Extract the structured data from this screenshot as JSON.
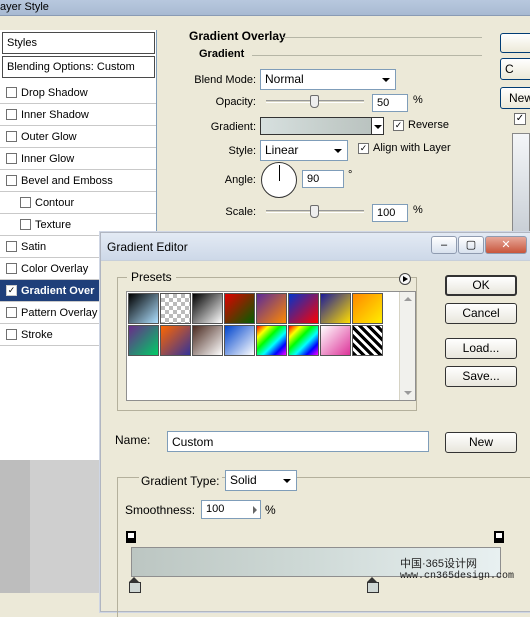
{
  "layer_style": {
    "title": "ayer Style",
    "styles_header": "Styles",
    "blending_options": "Blending Options: Custom",
    "items": [
      {
        "label": "Drop Shadow",
        "checked": false,
        "indent": false,
        "selected": false
      },
      {
        "label": "Inner Shadow",
        "checked": false,
        "indent": false,
        "selected": false
      },
      {
        "label": "Outer Glow",
        "checked": false,
        "indent": false,
        "selected": false
      },
      {
        "label": "Inner Glow",
        "checked": false,
        "indent": false,
        "selected": false
      },
      {
        "label": "Bevel and Emboss",
        "checked": false,
        "indent": false,
        "selected": false
      },
      {
        "label": "Contour",
        "checked": false,
        "indent": true,
        "selected": false
      },
      {
        "label": "Texture",
        "checked": false,
        "indent": true,
        "selected": false
      },
      {
        "label": "Satin",
        "checked": false,
        "indent": false,
        "selected": false
      },
      {
        "label": "Color Overlay",
        "checked": false,
        "indent": false,
        "selected": false
      },
      {
        "label": "Gradient Over",
        "checked": true,
        "indent": false,
        "selected": true
      },
      {
        "label": "Pattern Overlay",
        "checked": false,
        "indent": false,
        "selected": false
      },
      {
        "label": "Stroke",
        "checked": false,
        "indent": false,
        "selected": false
      }
    ],
    "panel": {
      "section_title": "Gradient Overlay",
      "group_title": "Gradient",
      "blend_mode_label": "Blend Mode:",
      "blend_mode_value": "Normal",
      "opacity_label": "Opacity:",
      "opacity_value": "50",
      "opacity_unit": "%",
      "opacity_level": 0.5,
      "gradient_label": "Gradient:",
      "reverse_label": "Reverse",
      "reverse_checked": true,
      "style_label": "Style:",
      "style_value": "Linear",
      "align_label": "Align with Layer",
      "align_checked": true,
      "angle_label": "Angle:",
      "angle_value": "90",
      "angle_unit": "°",
      "scale_label": "Scale:",
      "scale_value": "100",
      "scale_unit": "%",
      "scale_level": 0.5
    },
    "side_buttons": [
      "",
      "C",
      "New"
    ]
  },
  "gradient_editor": {
    "title": "Gradient Editor",
    "presets_label": "Presets",
    "buttons": {
      "ok": "OK",
      "cancel": "Cancel",
      "load": "Load...",
      "save": "Save...",
      "new": "New"
    },
    "name_label": "Name:",
    "name_value": "Custom",
    "gradient_type_label": "Gradient Type:",
    "gradient_type_value": "Solid",
    "smoothness_label": "Smoothness:",
    "smoothness_value": "100",
    "smoothness_unit": "%",
    "swatch_colors": [
      [
        "#000000",
        "#aee0ff"
      ],
      [
        "#777777",
        "#ffffff"
      ],
      [
        "#000000",
        "#ffffff"
      ],
      [
        "#e00000",
        "#006000"
      ],
      [
        "#5a2a9a",
        "#ff8a00"
      ],
      [
        "#0033cc",
        "#ff0000"
      ],
      [
        "#1a1a9a",
        "#ffdd00"
      ],
      [
        "#ff8800",
        "#ffee00"
      ],
      [
        "#6a2a8a",
        "#00cc66"
      ],
      [
        "#ff6600",
        "#333399"
      ],
      [
        "#4a2a20",
        "#ffffff"
      ],
      [
        "#0044cc",
        "#ffffff"
      ],
      [
        "#ff0000",
        "#00ff88"
      ],
      [
        "#ff0099",
        "#00ccff"
      ],
      [
        "#ffffff",
        "#dd3399"
      ],
      [
        "#000000",
        "#ffffff"
      ]
    ]
  },
  "watermark": {
    "line1": "中国·365设计网",
    "line2": "www.cn365design.com"
  }
}
